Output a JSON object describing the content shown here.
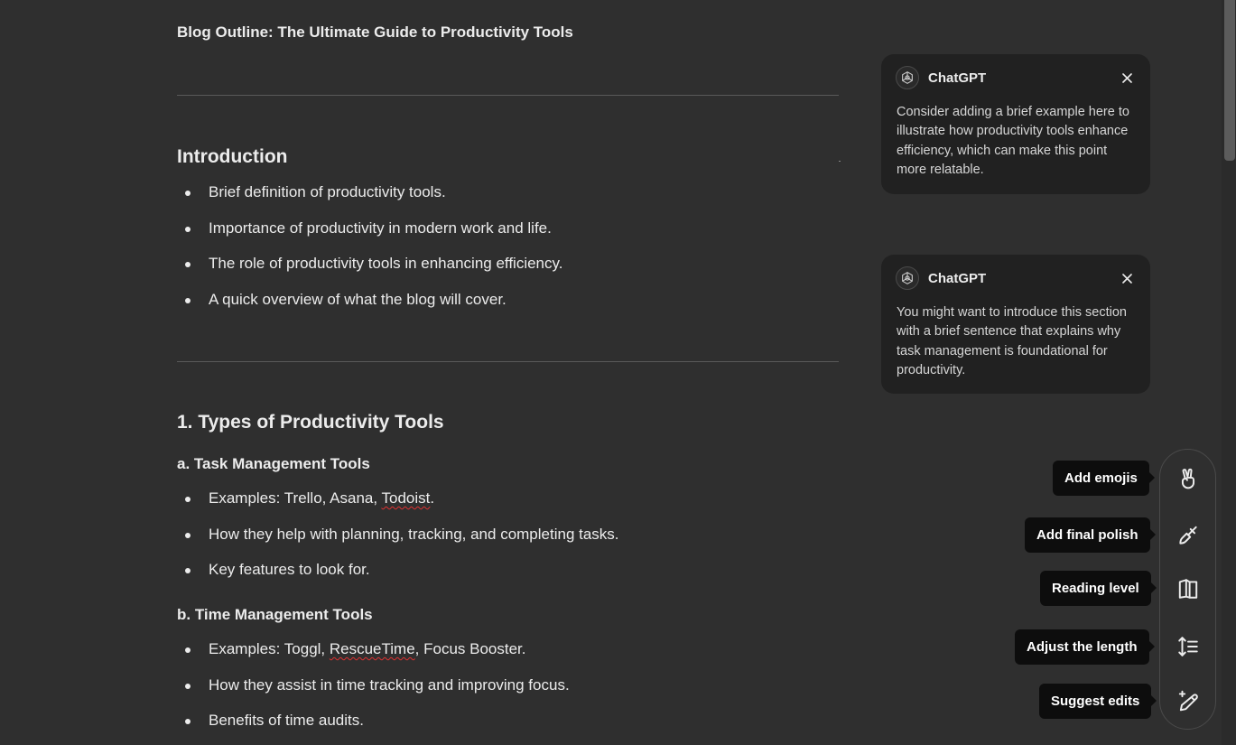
{
  "document": {
    "title": "Blog Outline: The Ultimate Guide to Productivity Tools",
    "sections": {
      "intro": {
        "heading": "Introduction",
        "bullets": [
          "Brief definition of productivity tools.",
          "Importance of productivity in modern work and life.",
          "The role of productivity tools in enhancing efficiency.",
          "A quick overview of what the blog will cover."
        ]
      },
      "types": {
        "heading": "1. Types of Productivity Tools",
        "task": {
          "heading": "a. Task Management Tools",
          "bullet1_prefix": "Examples: Trello, Asana, ",
          "bullet1_misspelled": "Todoist",
          "bullet1_suffix": ".",
          "bullets": [
            "How they help with planning, tracking, and completing tasks.",
            "Key features to look for."
          ]
        },
        "time": {
          "heading": "b. Time Management Tools",
          "bullet1_prefix": "Examples: Toggl, ",
          "bullet1_misspelled": "RescueTime",
          "bullet1_suffix": ", Focus Booster.",
          "bullets": [
            "How they assist in time tracking and improving focus.",
            "Benefits of time audits."
          ]
        }
      }
    }
  },
  "comments": [
    {
      "author": "ChatGPT",
      "text": "Consider adding a brief example here to illustrate how productivity tools enhance efficiency, which can make this point more relatable."
    },
    {
      "author": "ChatGPT",
      "text": "You might want to introduce this section with a brief sentence that explains why task management is foundational for productivity."
    }
  ],
  "toolbar": {
    "emojis": "Add emojis",
    "polish": "Add final polish",
    "reading": "Reading level",
    "length": "Adjust the length",
    "edits": "Suggest edits"
  },
  "icons": {
    "comment_avatar": "openai-logo-icon",
    "comment_close": "close-icon",
    "emojis": "peace-hand-icon",
    "polish": "paintbrush-icon",
    "reading": "book-icon",
    "length": "text-height-icon",
    "edits": "pencil-sparkle-icon"
  },
  "colors": {
    "background": "#2f2f2f",
    "card": "#212121",
    "tooltip": "#0d0d0d",
    "text": "#ececec",
    "spellcheck": "#e03131"
  }
}
